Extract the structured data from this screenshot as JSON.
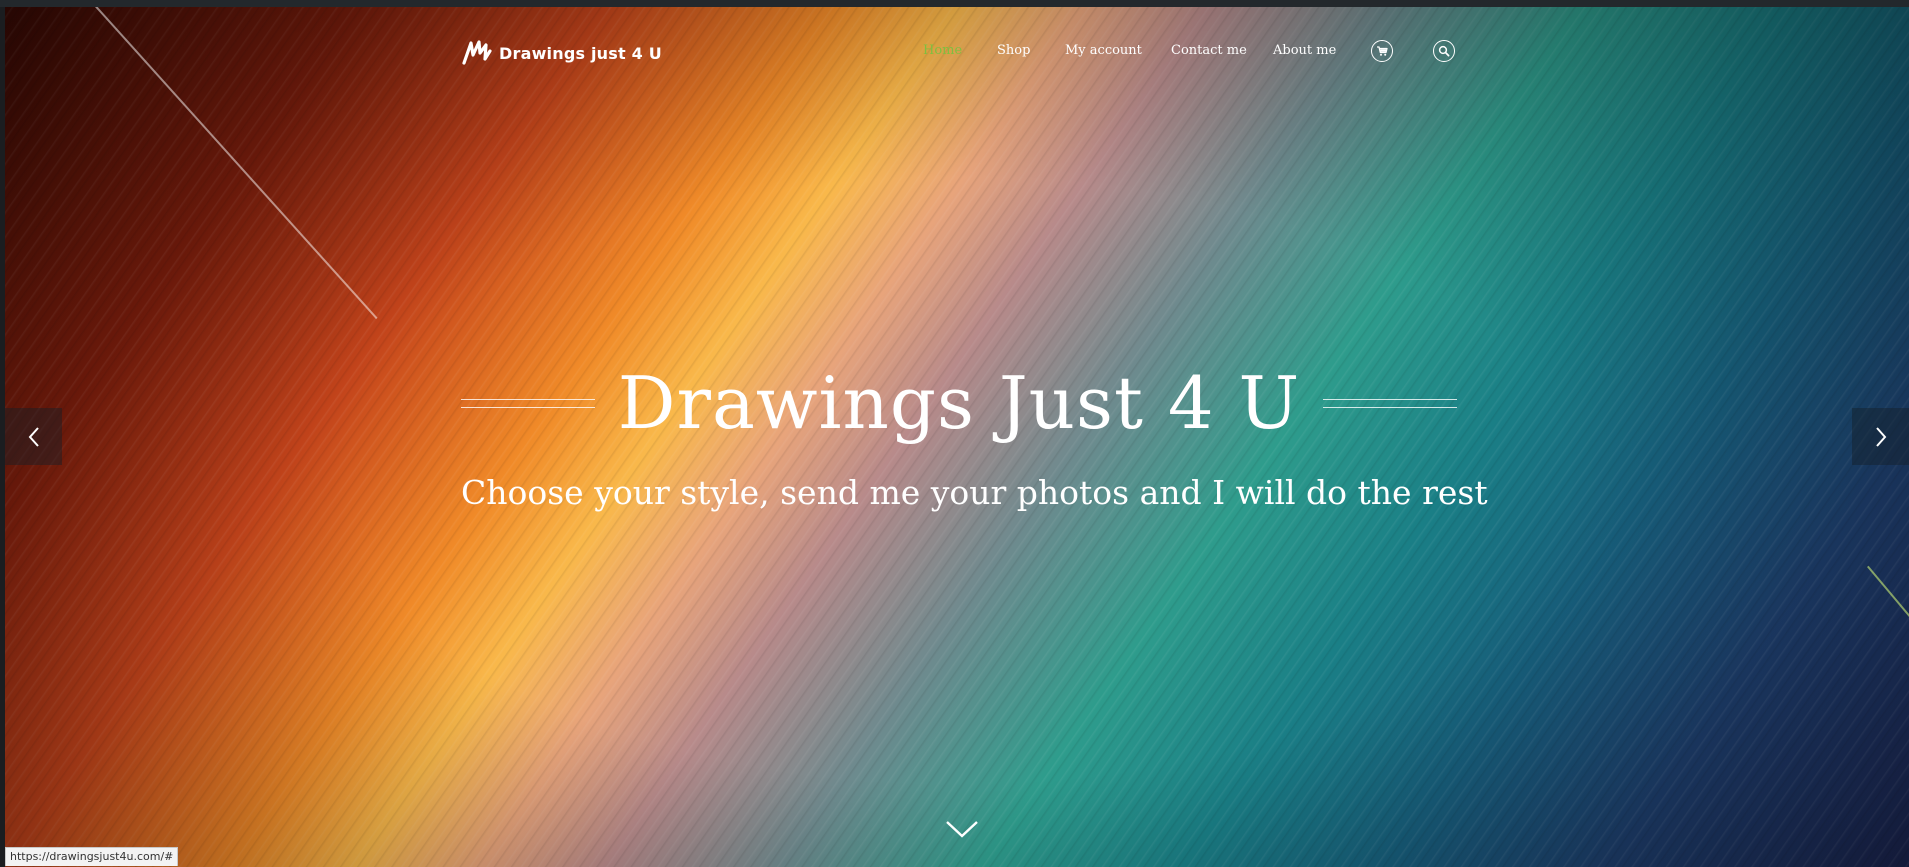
{
  "site": {
    "logo_text": "Drawings just 4 U"
  },
  "nav": {
    "items": [
      {
        "label": "Home",
        "active": true
      },
      {
        "label": "Shop",
        "active": false
      },
      {
        "label": "My account",
        "active": false
      },
      {
        "label": "Contact me",
        "active": false
      },
      {
        "label": "About me",
        "active": false
      }
    ],
    "icons": [
      "cart-icon",
      "search-icon"
    ]
  },
  "hero": {
    "title": "Drawings Just 4 U",
    "subtitle": "Choose your style, send me your photos and I will do the rest"
  },
  "slider": {
    "prev_icon": "chevron-left-icon",
    "next_icon": "chevron-right-icon",
    "scroll_icon": "chevron-down-icon"
  },
  "statusbar": {
    "url": "https://drawingsjust4u.com/#"
  },
  "colors": {
    "nav_active": "#7fbf3f",
    "text": "#ffffff"
  }
}
